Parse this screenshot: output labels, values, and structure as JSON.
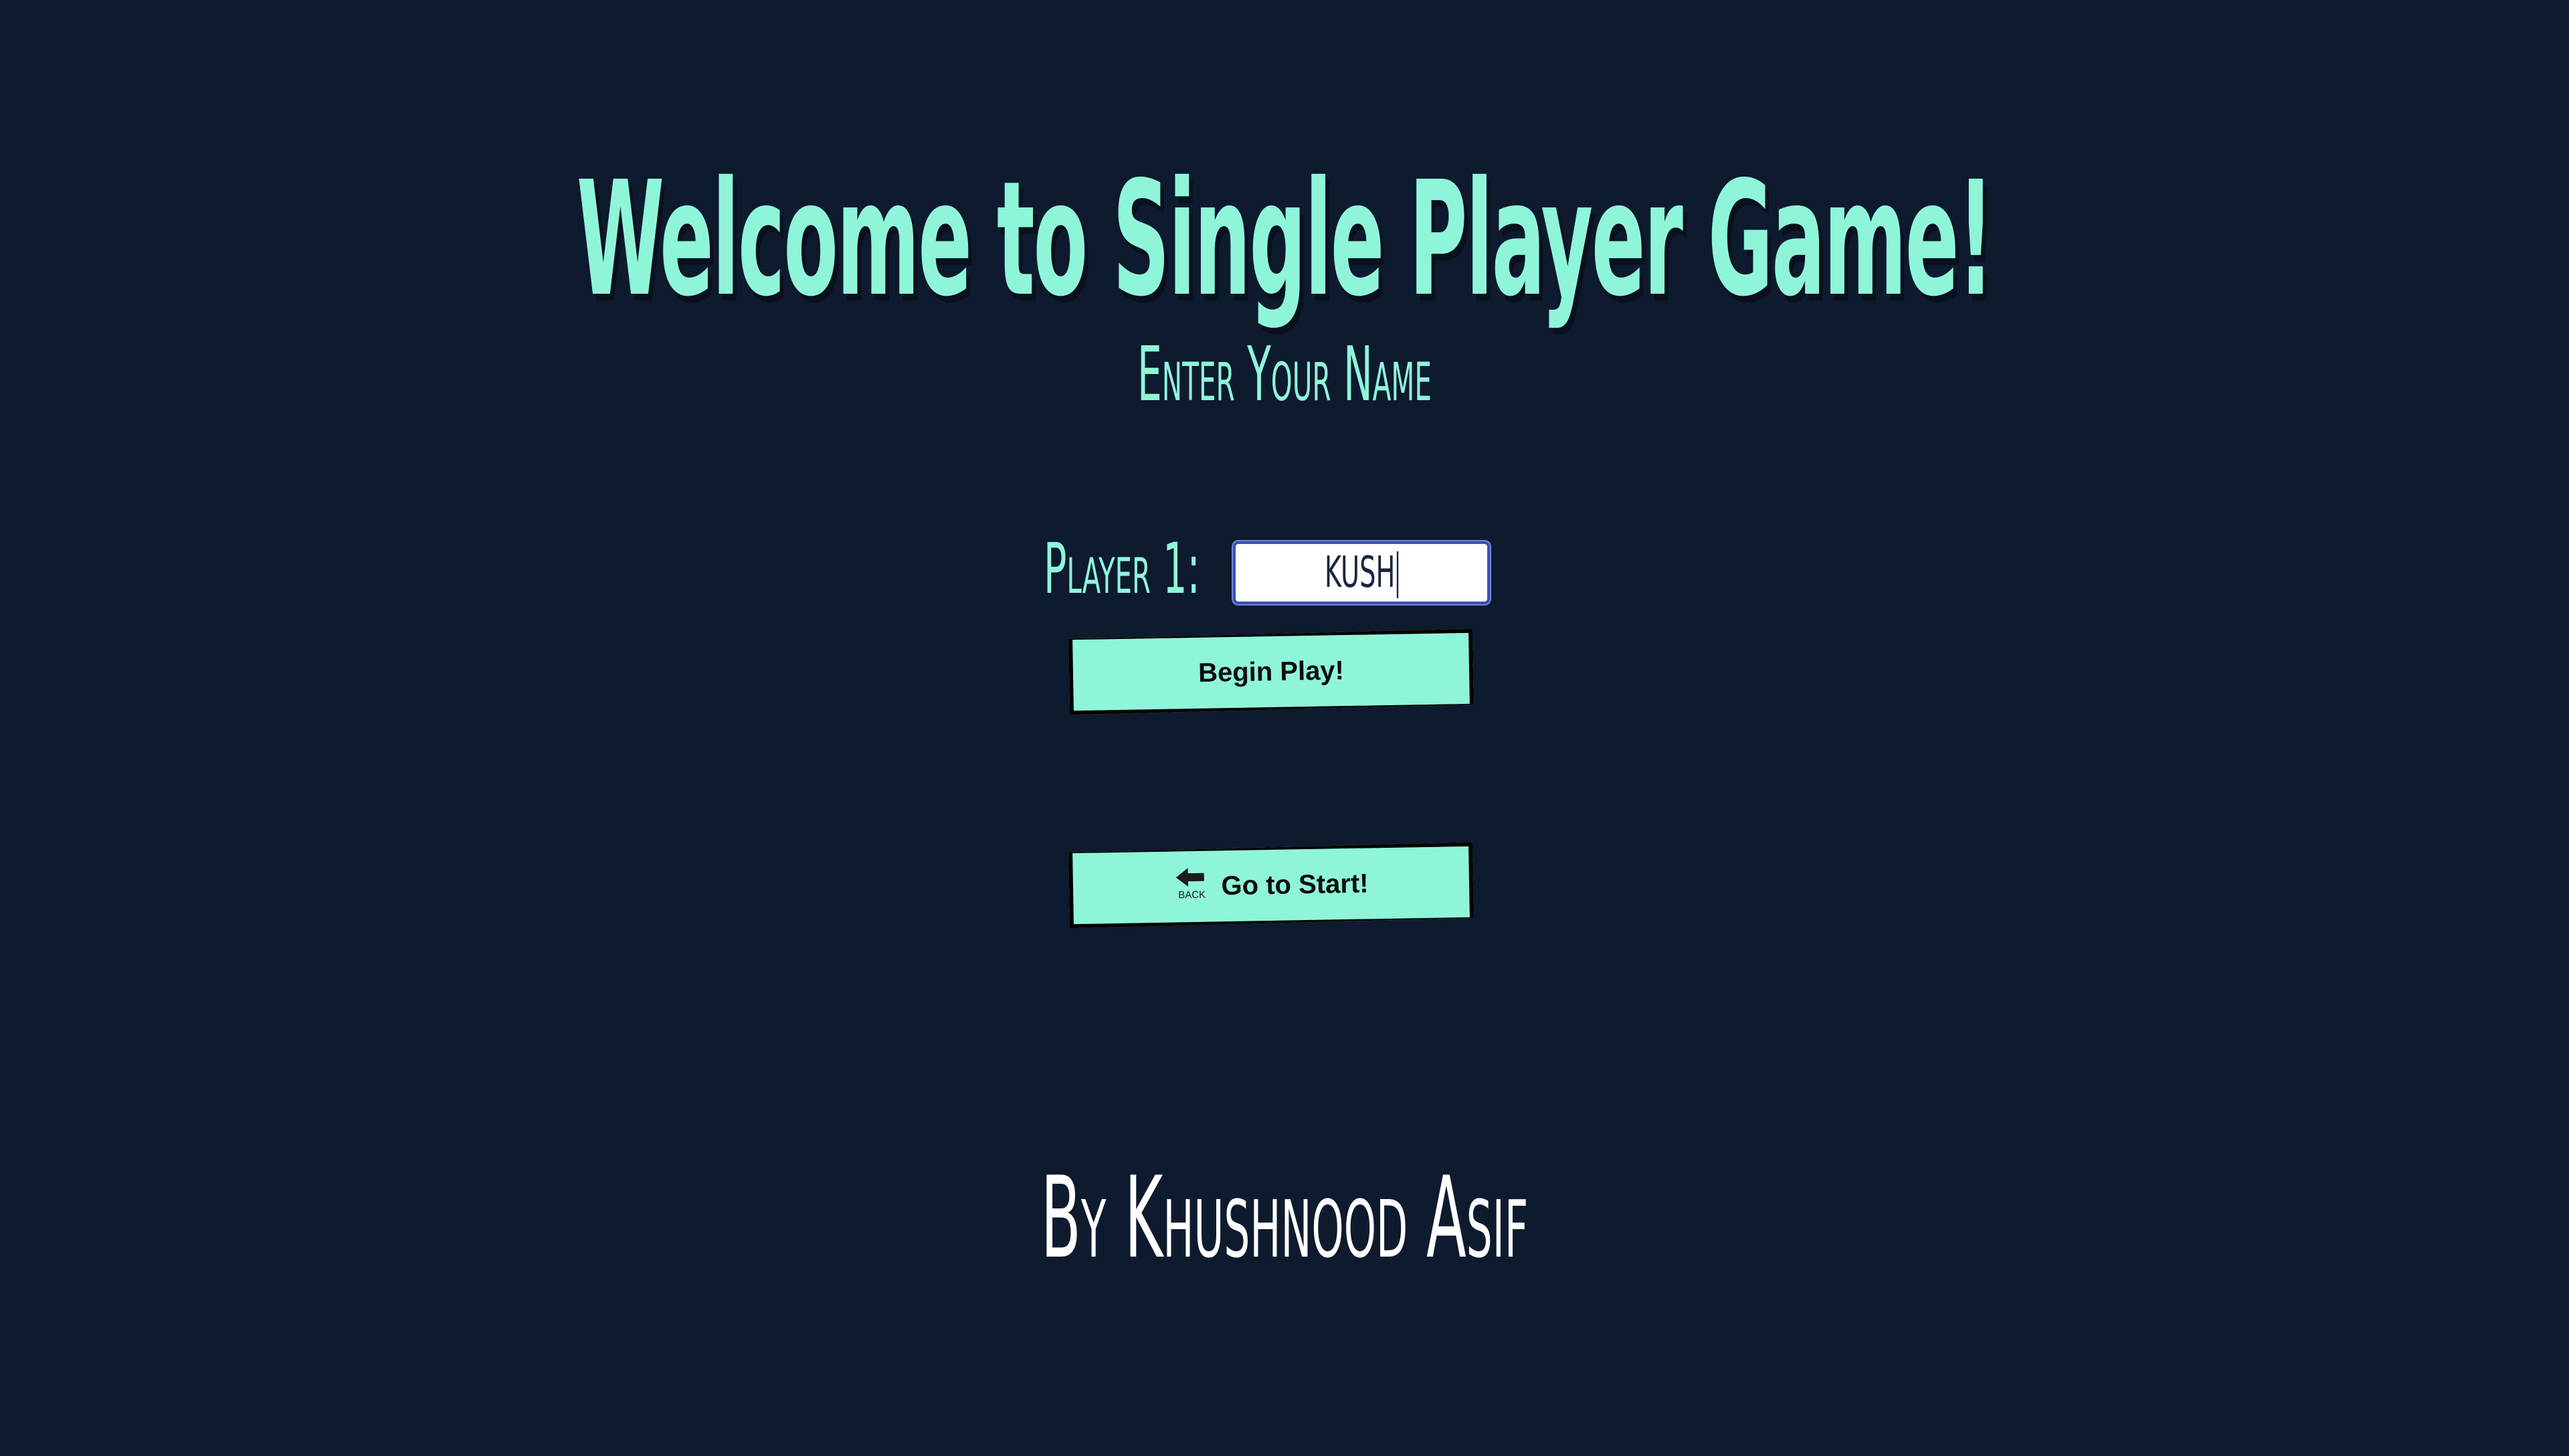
{
  "header": {
    "title": "Welcome to Single Player Game!"
  },
  "form": {
    "prompt": "Enter Your Name",
    "player_label": "Player 1:",
    "player_name_value": "KUSH"
  },
  "buttons": {
    "begin_label": "Begin Play!",
    "start_label": "Go to Start!",
    "back_icon_text": "BACK"
  },
  "footer": {
    "author": "By Khushnood Asif"
  },
  "colors": {
    "background": "#0e1a2e",
    "accent": "#8ff5d9",
    "footer_text": "#ffffff"
  },
  "icons": {
    "back": "back-arrow-icon"
  }
}
